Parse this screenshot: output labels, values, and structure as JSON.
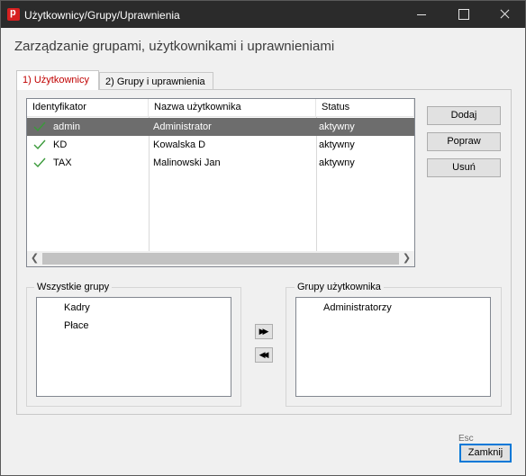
{
  "window": {
    "title": "Użytkownicy/Grupy/Uprawnienia",
    "app_icon_letter": "p",
    "icons": {
      "minimize": "minimize-icon",
      "maximize": "maximize-icon",
      "close": "close-icon"
    }
  },
  "heading": "Zarządzanie grupami, użytkownikami i uprawnieniami",
  "tabs": [
    {
      "label": "1) Użytkownicy",
      "active": true
    },
    {
      "label": "2) Grupy i uprawnienia",
      "active": false
    }
  ],
  "users_table": {
    "columns": [
      "Identyfikator",
      "Nazwa użytkownika",
      "Status"
    ],
    "rows": [
      {
        "id": "admin",
        "name": "Administrator",
        "status": "aktywny",
        "checked": true,
        "selected": true
      },
      {
        "id": "KD",
        "name": "Kowalska D",
        "status": "aktywny",
        "checked": true,
        "selected": false
      },
      {
        "id": "TAX",
        "name": "Malinowski Jan",
        "status": "aktywny",
        "checked": true,
        "selected": false
      }
    ]
  },
  "buttons": {
    "add": "Dodaj",
    "edit": "Popraw",
    "delete": "Usuń",
    "close": "Zamknij",
    "assign_group": "▶▶",
    "unassign_group": "◀◀"
  },
  "all_groups": {
    "title": "Wszystkie grupy",
    "items": [
      "Kadry",
      "Płace"
    ]
  },
  "user_groups": {
    "title": "Grupy użytkownika",
    "items": [
      "Administratorzy"
    ]
  },
  "close_shortcut": "Esc",
  "colors": {
    "titlebar": "#2b2b2b",
    "active_tab_text": "#c00000",
    "selected_row": "#6d6d6d",
    "check": "#3a9a3a"
  }
}
